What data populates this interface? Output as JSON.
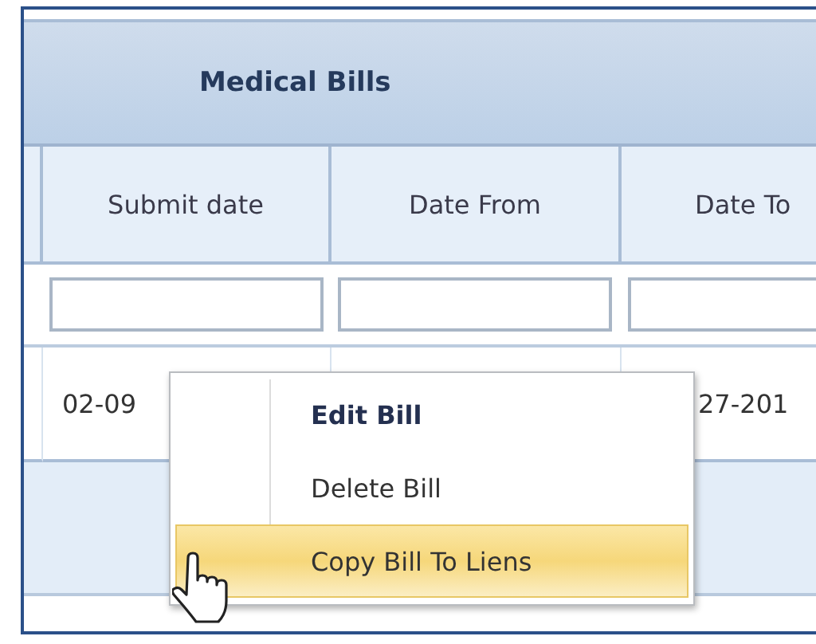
{
  "grid": {
    "title": "Medical Bills",
    "columns": [
      "Submit date",
      "Date From",
      "Date To"
    ],
    "filters": [
      {
        "kind": "text"
      },
      {
        "kind": "text"
      },
      {
        "kind": "text"
      }
    ],
    "rows": [
      {
        "submit_date": "02-09",
        "date_to": "27-201"
      }
    ]
  },
  "context_menu": {
    "items": [
      {
        "label": "Edit Bill",
        "default": true,
        "selected": false
      },
      {
        "label": "Delete Bill",
        "default": false,
        "selected": false
      },
      {
        "label": "Copy Bill To Liens",
        "default": false,
        "selected": true
      }
    ]
  }
}
